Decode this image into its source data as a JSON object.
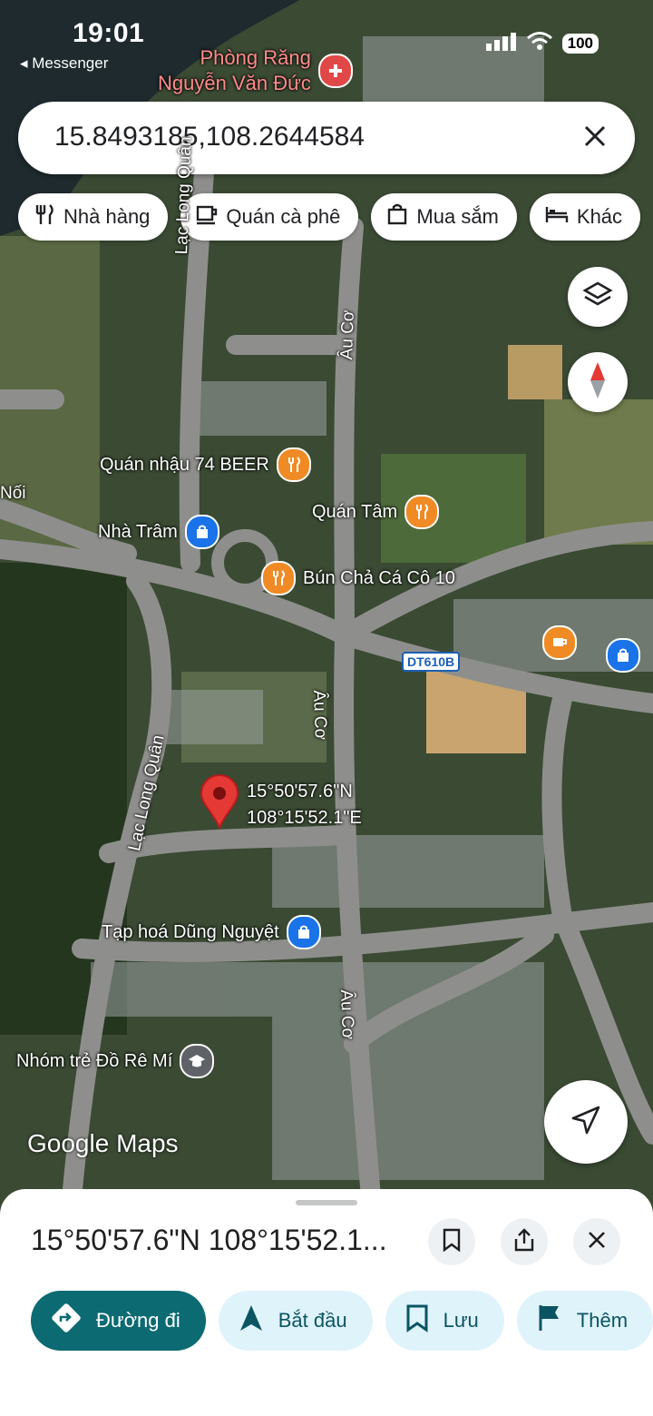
{
  "status": {
    "time": "19:01",
    "back_app": "Messenger",
    "battery": "100"
  },
  "search": {
    "query": "15.8493185,108.2644584"
  },
  "chips": [
    {
      "label": "Nhà hàng",
      "icon": "restaurant-icon"
    },
    {
      "label": "Quán cà phê",
      "icon": "coffee-icon"
    },
    {
      "label": "Mua sắm",
      "icon": "shopping-bag-icon"
    },
    {
      "label": "Khác",
      "icon": "hotel-icon"
    }
  ],
  "map": {
    "places": {
      "dentist": "Phòng Răng\nNguyễn Văn Đức",
      "beer": "Quán nhậu 74 BEER",
      "tram": "Nhà Trâm",
      "tam": "Quán Tâm",
      "bun": "Bún Chả Cá Cô 10",
      "grocery": "Tạp hoá Dũng Nguyệt",
      "school": "Nhóm trẻ Đồ Rê Mí"
    },
    "roads": {
      "lac_long_quan": "Lạc Long Quân",
      "au_co": "Âu Cơ",
      "noi": "Nối",
      "dt610b": "DT610B"
    },
    "pin_label": {
      "lat": "15°50'57.6\"N",
      "lng": "108°15'52.1\"E"
    },
    "watermark": "Google Maps"
  },
  "sheet": {
    "title": "15°50'57.6\"N 108°15'52.1...",
    "actions": [
      {
        "label": "Đường đi",
        "icon": "directions-icon"
      },
      {
        "label": "Bắt đầu",
        "icon": "navigation-arrow-icon"
      },
      {
        "label": "Lưu",
        "icon": "bookmark-icon"
      },
      {
        "label": "Thêm",
        "icon": "flag-icon"
      }
    ]
  },
  "colors": {
    "accent": "#0b6a72",
    "pin": "#e53935",
    "action_bg": "#dff3fb"
  }
}
